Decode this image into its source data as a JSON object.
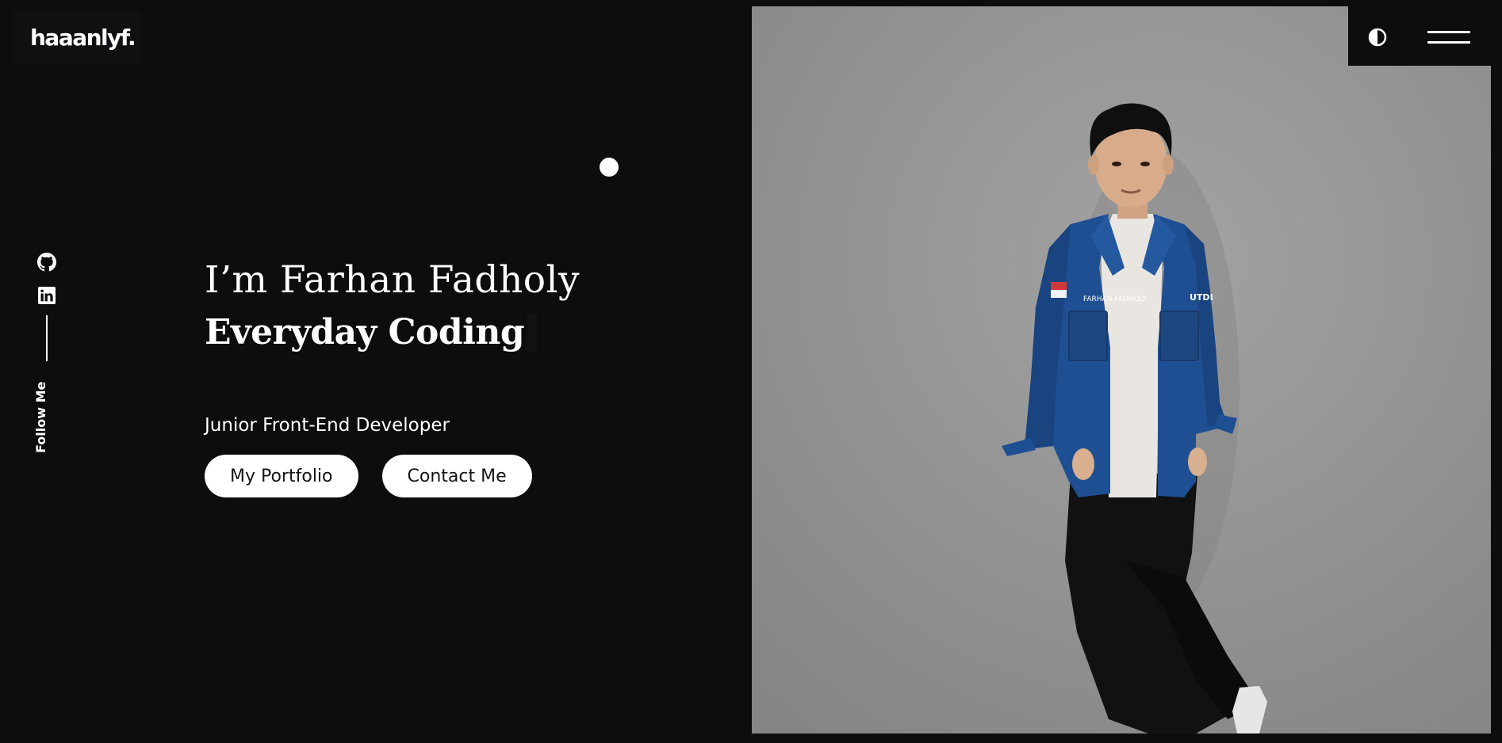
{
  "brand": {
    "logo": "haaanlyf."
  },
  "social": {
    "items": [
      {
        "name": "github",
        "icon": "github-icon"
      },
      {
        "name": "linkedin",
        "icon": "linkedin-icon"
      }
    ],
    "follow_label": "Follow Me"
  },
  "hero": {
    "intro": "I’m Farhan Fadholy",
    "typed_text": "Everyday Coding",
    "role": "Junior Front-End Developer",
    "buttons": {
      "portfolio": "My Portfolio",
      "contact": "Contact Me"
    }
  },
  "header": {
    "theme_toggle_icon": "contrast-icon",
    "menu_icon": "hamburger-menu-icon"
  },
  "photo": {
    "subject": "portrait-photo",
    "jacket_name_label": "FARHAN FADHOLY",
    "jacket_logo": "UTDI"
  },
  "colors": {
    "background": "#0d0d0e",
    "text": "#ffffff",
    "button_bg": "#ffffff",
    "button_text": "#141414",
    "jacket_blue": "#1f4f93"
  }
}
